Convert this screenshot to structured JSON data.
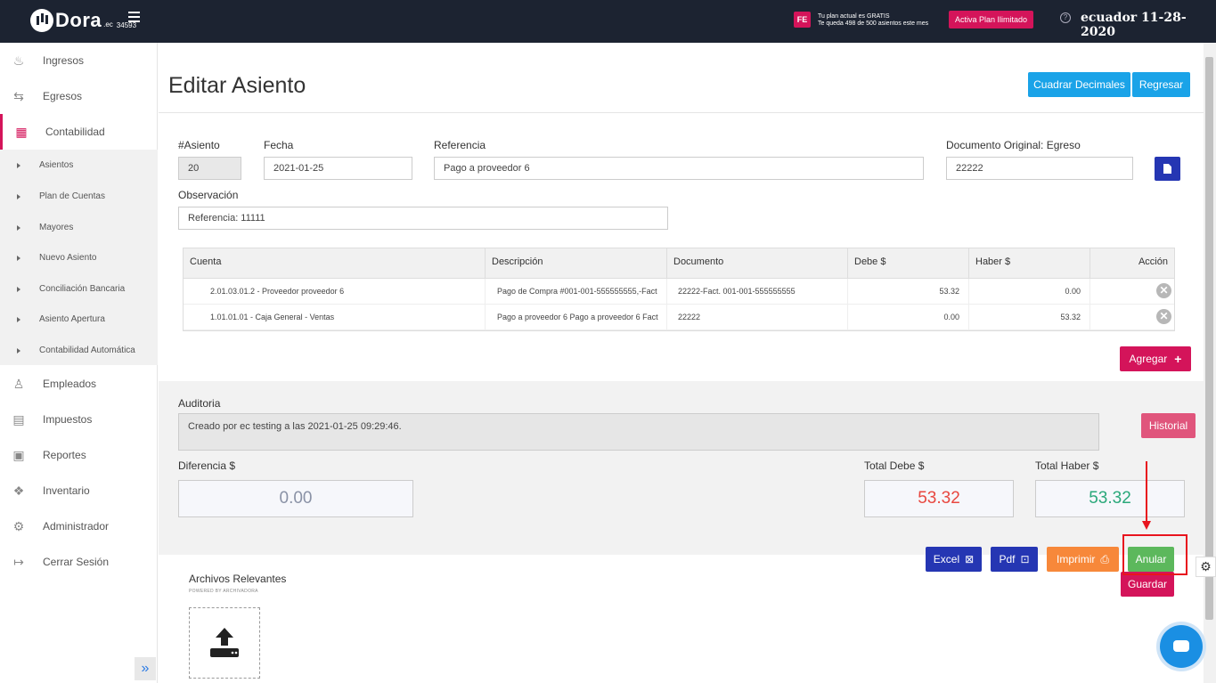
{
  "topbar": {
    "logo_text": "Dora",
    "logo_sub": ".ec",
    "logo_code": "34593",
    "fe_badge": "FE",
    "plan_line1": "Tu plan actual es GRATIS",
    "plan_line2": "Te queda 498 de 500 asientos este mes",
    "plan_button": "Activa Plan Ilimitado",
    "help_glyph": "?",
    "user_date": "ecuador 11-28-2020"
  },
  "sidebar": {
    "items": [
      {
        "label": "Ingresos",
        "icon": "moneybag-icon",
        "glyph": "♨"
      },
      {
        "label": "Egresos",
        "icon": "transfer-icon",
        "glyph": "⇆"
      },
      {
        "label": "Contabilidad",
        "icon": "calculator-icon",
        "glyph": "▦"
      },
      {
        "label": "Empleados",
        "icon": "people-icon",
        "glyph": "♙"
      },
      {
        "label": "Impuestos",
        "icon": "tax-icon",
        "glyph": "▤"
      },
      {
        "label": "Reportes",
        "icon": "report-icon",
        "glyph": "▣"
      },
      {
        "label": "Inventario",
        "icon": "boxes-icon",
        "glyph": "❖"
      },
      {
        "label": "Administrador",
        "icon": "gear-icon",
        "glyph": "⚙"
      },
      {
        "label": "Cerrar Sesión",
        "icon": "logout-icon",
        "glyph": "↦"
      }
    ],
    "sub_items": [
      "Asientos",
      "Plan de Cuentas",
      "Mayores",
      "Nuevo Asiento",
      "Conciliación Bancaria",
      "Asiento Apertura",
      "Contabilidad Automática"
    ],
    "expand_glyph": "»"
  },
  "page": {
    "title": "Editar Asiento",
    "btn_cuadrar": "Cuadrar Decimales",
    "btn_regresar": "Regresar"
  },
  "form": {
    "asiento_label": "#Asiento",
    "asiento_value": "20",
    "fecha_label": "Fecha",
    "fecha_value": "2021-01-25",
    "referencia_label": "Referencia",
    "referencia_value": "Pago a proveedor 6",
    "documento_label": "Documento Original: Egreso",
    "documento_value": "22222",
    "observacion_label": "Observación",
    "observacion_value": "Referencia: 11111"
  },
  "table": {
    "headers": [
      "Cuenta",
      "Descripción",
      "Documento",
      "Debe $",
      "Haber $",
      "Acción"
    ],
    "rows": [
      {
        "cuenta": "2.01.03.01.2 - Proveedor proveedor 6",
        "descripcion": "Pago de Compra #001-001-555555555,-Fact",
        "documento": "22222-Fact. 001-001-555555555",
        "debe": "53.32",
        "haber": "0.00"
      },
      {
        "cuenta": "1.01.01.01 - Caja General - Ventas",
        "descripcion": "Pago a proveedor 6 Pago a proveedor 6 Fact",
        "documento": "22222",
        "debe": "0.00",
        "haber": "53.32"
      }
    ],
    "delete_glyph": "✕"
  },
  "actions": {
    "agregar": "Agregar",
    "agregar_glyph": "+",
    "historial": "Historial",
    "excel": "Excel",
    "pdf": "Pdf",
    "imprimir": "Imprimir",
    "anular": "Anular",
    "guardar": "Guardar",
    "excel_glyph": "⊠",
    "pdf_glyph": "⊡",
    "print_glyph": "⎙"
  },
  "audit": {
    "label": "Auditoria",
    "text": "Creado por ec testing a las 2021-01-25 09:29:46."
  },
  "totals": {
    "diferencia_label": "Diferencia $",
    "diferencia_value": "0.00",
    "debe_label": "Total Debe $",
    "debe_value": "53.32",
    "haber_label": "Total Haber $",
    "haber_value": "53.32"
  },
  "archivos": {
    "title": "Archivos Relevantes",
    "powered": "POWERED BY ARCHIVADORA"
  },
  "colors": {
    "accent": "#d4145a",
    "info": "#1aa3e8",
    "navy": "#2536b3",
    "success": "#5cb85c",
    "warning": "#f7883a",
    "debe_total": "#e8473f",
    "haber_total": "#2aa87a"
  },
  "misc": {
    "side_gear_glyph": "⚙"
  }
}
